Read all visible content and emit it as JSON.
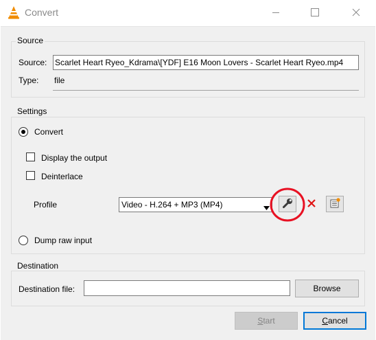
{
  "window": {
    "title": "Convert"
  },
  "colors": {
    "vlc_orange": "#f08c00",
    "annotation_red": "#e81123",
    "delete_red": "#e01515",
    "focus_blue": "#0078d7"
  },
  "icons": {
    "app": "vlc-cone-icon",
    "minimize": "minimize-icon",
    "maximize": "maximize-icon",
    "close": "close-icon",
    "edit_profile": "wrench-icon",
    "delete_profile": "delete-x-icon",
    "new_profile": "new-profile-icon",
    "dropdown": "chevron-down-icon"
  },
  "source": {
    "group_label": "Source",
    "source_label": "Source:",
    "source_value": "Scarlet Heart Ryeo_Kdrama\\[YDF] E16 Moon Lovers - Scarlet Heart Ryeo.mp4",
    "type_label": "Type:",
    "type_value": "file"
  },
  "settings": {
    "group_label": "Settings",
    "convert_label": "Convert",
    "convert_checked": true,
    "display_output_label": "Display the output",
    "display_output_checked": false,
    "deinterlace_label": "Deinterlace",
    "deinterlace_checked": false,
    "profile_label": "Profile",
    "profile_selected": "Video - H.264 + MP3 (MP4)",
    "dump_raw_label": "Dump raw input",
    "dump_raw_checked": false
  },
  "destination": {
    "group_label": "Destination",
    "file_label": "Destination file:",
    "file_value": "",
    "browse_label": "Browse"
  },
  "footer": {
    "start_label": "Start",
    "start_mnemonic": "S",
    "start_rest": "tart",
    "cancel_label": "Cancel",
    "cancel_mnemonic": "C",
    "cancel_rest": "ancel"
  }
}
